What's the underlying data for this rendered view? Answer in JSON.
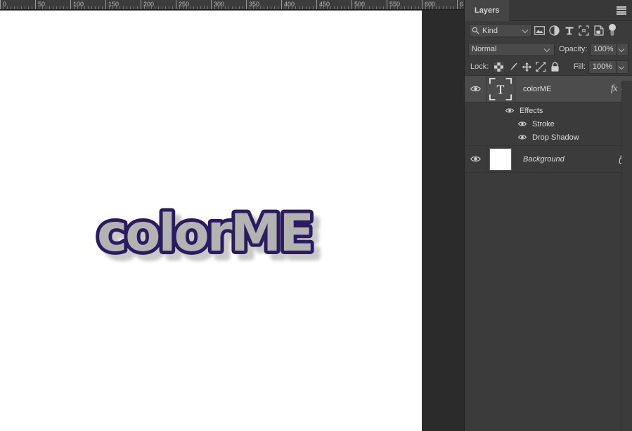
{
  "document": {
    "ruler": {
      "unit_step": 50,
      "labels": [
        "0",
        "50",
        "100",
        "150",
        "200",
        "250",
        "300",
        "350",
        "400",
        "450",
        "500",
        "550",
        "600",
        "6"
      ],
      "max_visible": 650
    },
    "canvas": {
      "background_color": "#ffffff",
      "workspace_color": "#2b2b2b"
    },
    "artwork": {
      "text": "colorME",
      "fill_color": "#b3b3b3",
      "stroke_color": "#2b1a5e",
      "shadow_color": "#c9c9c9",
      "effects": [
        "Stroke",
        "Drop Shadow"
      ]
    }
  },
  "panel": {
    "tab_label": "Layers",
    "menu_icon": "hamburger-menu-icon",
    "filter": {
      "kind_label": "Kind",
      "search_icon": "search-icon",
      "buttons": [
        {
          "icon": "pixel-layer-filter-icon",
          "label": "Filter for pixel layers"
        },
        {
          "icon": "adjustment-layer-filter-icon",
          "label": "Filter for adjustment layers"
        },
        {
          "icon": "type-layer-filter-icon",
          "label": "Filter for type layers"
        },
        {
          "icon": "shape-layer-filter-icon",
          "label": "Filter for shape layers"
        },
        {
          "icon": "smart-object-filter-icon",
          "label": "Filter for smart objects"
        }
      ],
      "toggle_icon": "filter-toggle-switch-icon"
    },
    "blend": {
      "mode": "Normal",
      "opacity_label": "Opacity:",
      "opacity_value": "100%"
    },
    "lock": {
      "label": "Lock:",
      "buttons": [
        {
          "icon": "lock-transparent-pixels-icon",
          "label": "Lock transparent pixels"
        },
        {
          "icon": "lock-image-pixels-icon",
          "label": "Lock image pixels"
        },
        {
          "icon": "lock-position-icon",
          "label": "Lock position"
        },
        {
          "icon": "lock-artboard-nesting-icon",
          "label": "Prevent auto-nesting"
        },
        {
          "icon": "lock-all-icon",
          "label": "Lock all"
        }
      ],
      "fill_label": "Fill:",
      "fill_value": "100%"
    },
    "layers": [
      {
        "name": "colorME",
        "type": "type-layer",
        "selected": true,
        "visible": true,
        "italic": false,
        "has_fx": true,
        "fx_glyph": "fx",
        "thumbnail_icon": "type-layer-thumbnail-icon",
        "effects_group_label": "Effects",
        "effects": [
          "Stroke",
          "Drop Shadow"
        ]
      },
      {
        "name": "Background",
        "type": "background-layer",
        "selected": false,
        "visible": true,
        "italic": true,
        "has_fx": false,
        "locked": true,
        "thumbnail_icon": "background-thumbnail-icon"
      }
    ]
  },
  "colors": {
    "panel_bg": "#3b3b3b",
    "panel_header": "#383838",
    "tab_active": "#454545",
    "row_selected": "#4c4c4c",
    "field_bg": "#4a4a4a",
    "text": "#dcdcdc",
    "workspace": "#2b2b2b"
  }
}
